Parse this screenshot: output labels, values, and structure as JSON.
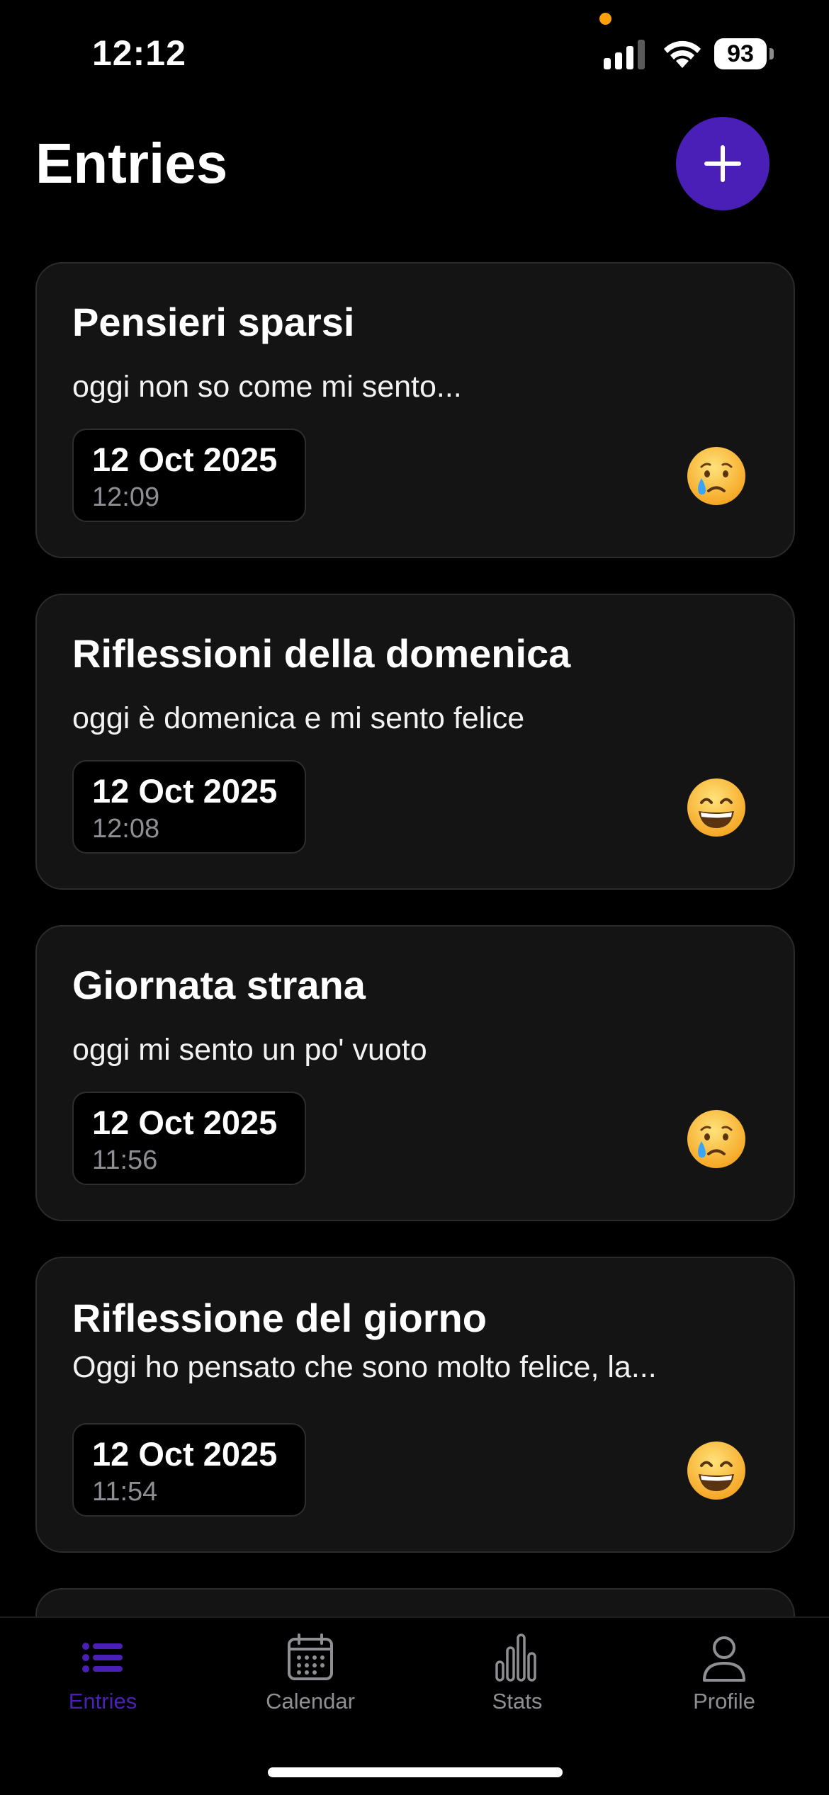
{
  "colors": {
    "background": "#000000",
    "card": "#141414",
    "accent": "#4a1fb8",
    "privacy_dot": "#ff9f0a",
    "secondary_text": "#8e8e93"
  },
  "status_bar": {
    "time": "12:12",
    "battery": "93",
    "icons": [
      "signal-icon",
      "wifi-icon",
      "battery-icon"
    ]
  },
  "header": {
    "title": "Entries",
    "add_icon": "plus-icon"
  },
  "entries": [
    {
      "title": "Pensieri sparsi",
      "excerpt": "oggi non so come mi sento...",
      "date": "12 Oct 2025",
      "time": "12:09",
      "mood": "crying-face"
    },
    {
      "title": "Riflessioni della domenica",
      "excerpt": "oggi è domenica e mi sento felice",
      "date": "12 Oct 2025",
      "time": "12:08",
      "mood": "grinning-face"
    },
    {
      "title": "Giornata strana",
      "excerpt": "oggi mi sento un po' vuoto",
      "date": "12 Oct 2025",
      "time": "11:56",
      "mood": "crying-face"
    },
    {
      "title": "Riflessione del giorno",
      "excerpt": "Oggi ho pensato che sono molto felice, la...",
      "date": "12 Oct 2025",
      "time": "11:54",
      "mood": "grinning-face"
    }
  ],
  "tab_bar": {
    "tabs": [
      {
        "label": "Entries",
        "icon": "list-icon",
        "active": true
      },
      {
        "label": "Calendar",
        "icon": "calendar-icon",
        "active": false
      },
      {
        "label": "Stats",
        "icon": "bar-chart-icon",
        "active": false
      },
      {
        "label": "Profile",
        "icon": "person-icon",
        "active": false
      }
    ]
  }
}
